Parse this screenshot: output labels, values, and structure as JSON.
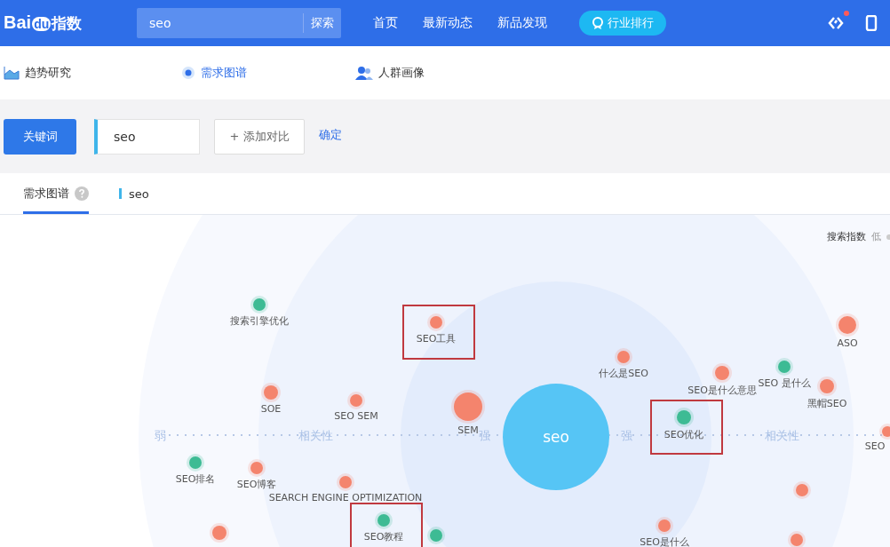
{
  "topbar": {
    "logo_left": "Bai",
    "logo_mid": "du",
    "logo_right": "指数",
    "search": {
      "value": "seo",
      "button": "探索"
    },
    "nav": [
      "首页",
      "最新动态",
      "新品发现"
    ],
    "ranking_button": "行业排行",
    "notification": true
  },
  "modules": [
    {
      "label": "趋势研究",
      "selected": false,
      "kind": "chart"
    },
    {
      "label": "需求图谱",
      "selected": true,
      "kind": "radio"
    },
    {
      "label": "人群画像",
      "selected": false,
      "kind": "people"
    }
  ],
  "keyword_bar": {
    "button": "关键词",
    "input": "seo",
    "add": "+ 添加对比",
    "confirm": "确定"
  },
  "panel": {
    "tabs": [
      {
        "label": "需求图谱",
        "selected": true
      }
    ],
    "legend_term": "seo",
    "scale_label": "搜索指数",
    "scale_low": "低"
  },
  "map": {
    "center": "seo",
    "axis_left": [
      "弱",
      "相关性",
      "强"
    ],
    "axis_right": [
      "强",
      "相关性"
    ],
    "nodes": [
      {
        "label": "搜索引擎优化",
        "color": "#3dbb94",
        "highlighted": false
      },
      {
        "label": "SEO工具",
        "color": "#f4846d",
        "highlighted": true
      },
      {
        "label": "SOE",
        "color": "#f4846d",
        "highlighted": false
      },
      {
        "label": "SEO SEM",
        "color": "#f4846d",
        "highlighted": false
      },
      {
        "label": "SEM",
        "color": "#f4846d",
        "highlighted": false
      },
      {
        "label": "SEO排名",
        "color": "#3dbb94",
        "highlighted": false
      },
      {
        "label": "SEO博客",
        "color": "#f4846d",
        "highlighted": false
      },
      {
        "label": "SEARCH ENGINE OPTIMIZATION",
        "color": "#f4846d",
        "highlighted": false
      },
      {
        "label": "SEO教程",
        "color": "#3dbb94",
        "highlighted": true
      },
      {
        "label": "什么是SEO",
        "color": "#f4846d",
        "highlighted": false
      },
      {
        "label": "SEO是什么意思",
        "color": "#f4846d",
        "highlighted": false
      },
      {
        "label": "SEO 是什么",
        "color": "#3dbb94",
        "highlighted": false
      },
      {
        "label": "黑帽SEO",
        "color": "#f4846d",
        "highlighted": false
      },
      {
        "label": "ASO",
        "color": "#f4846d",
        "highlighted": false
      },
      {
        "label": "SEO优化",
        "color": "#3dbb94",
        "highlighted": true
      },
      {
        "label": "SEO",
        "color": "#f4846d",
        "highlighted": false
      },
      {
        "label": "SEO是什么",
        "color": "#f4846d",
        "highlighted": false
      },
      {
        "color": "#f4846d",
        "highlighted": false
      },
      {
        "color": "#3dbb94",
        "highlighted": false
      },
      {
        "color": "#f4846d",
        "highlighted": false
      },
      {
        "color": "#f4846d",
        "highlighted": false
      }
    ]
  }
}
